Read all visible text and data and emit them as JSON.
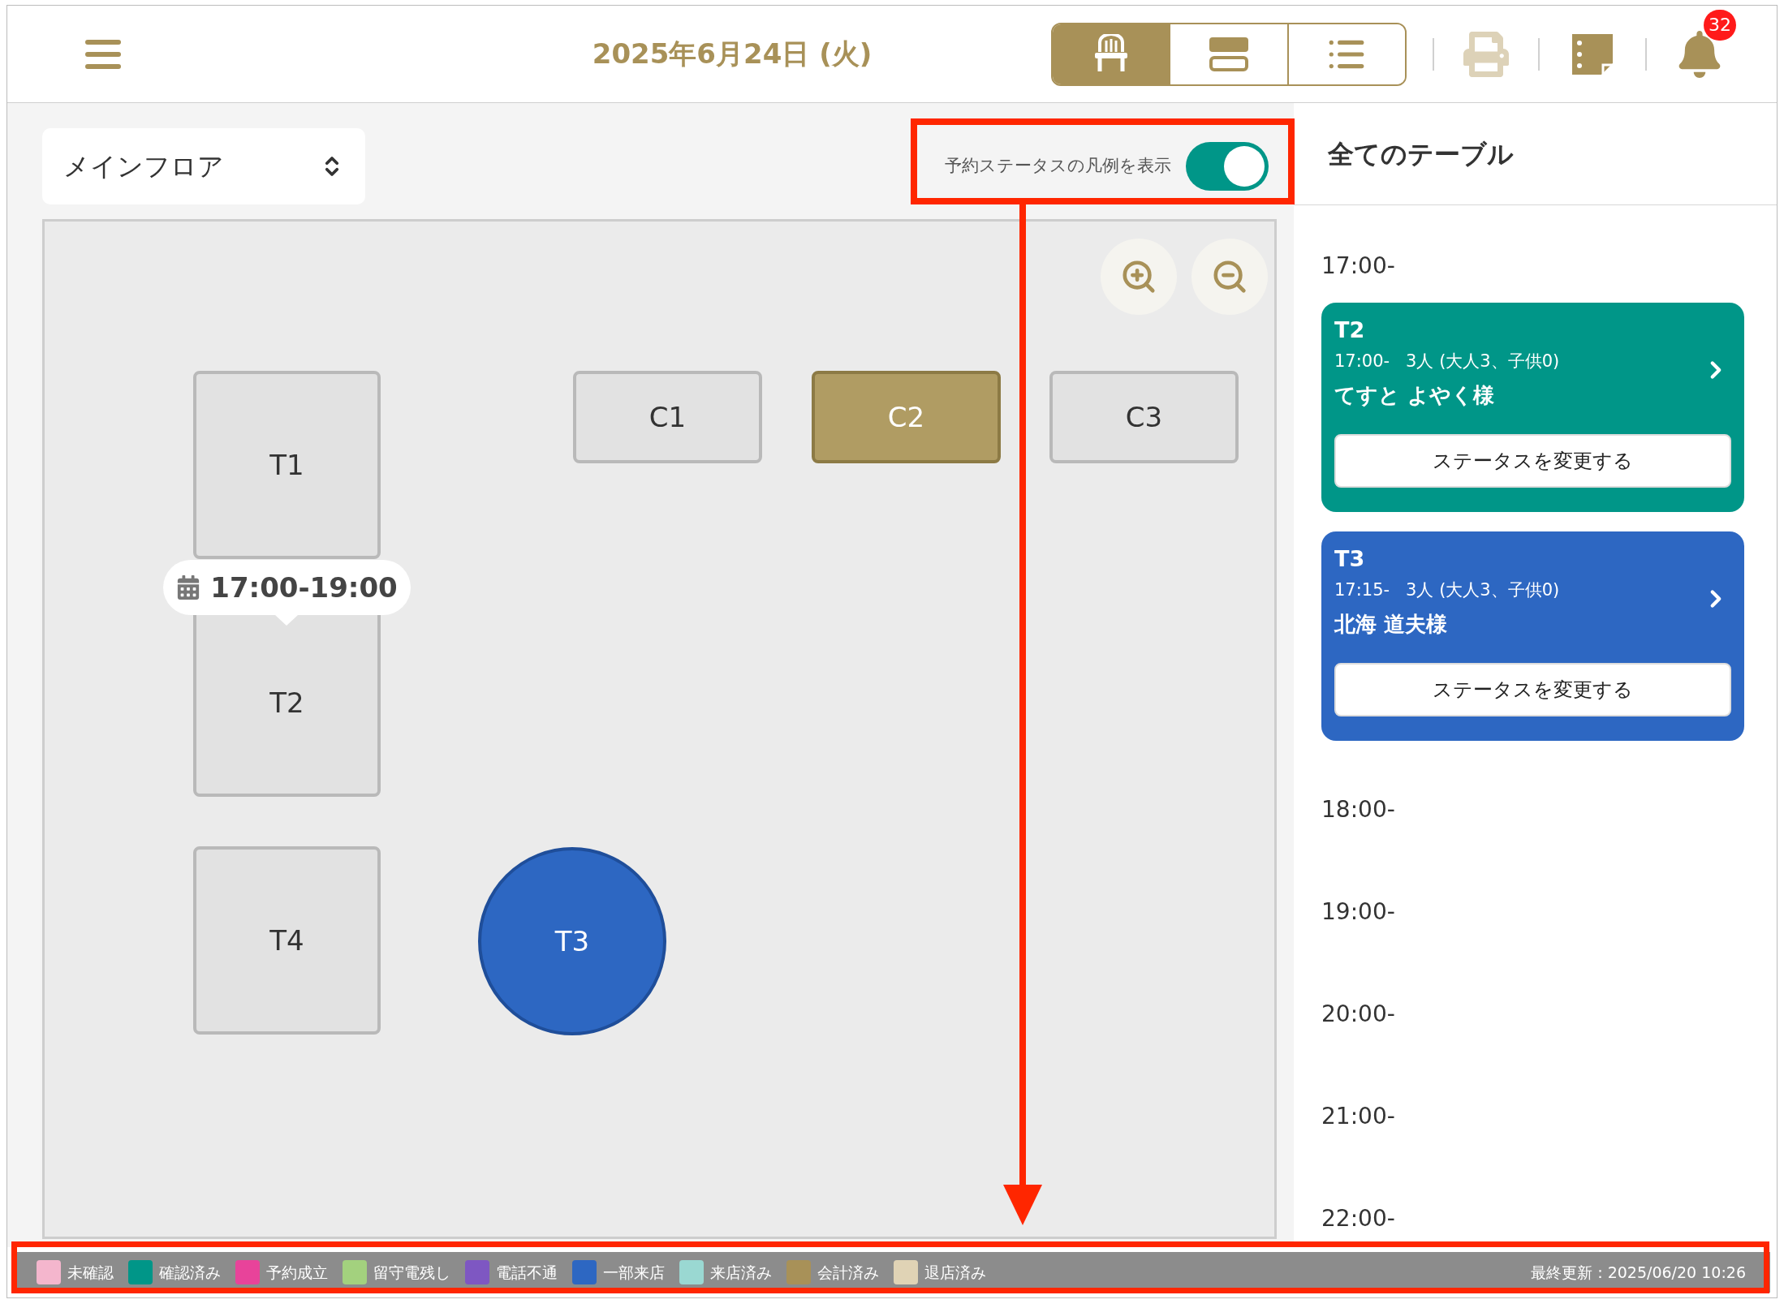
{
  "header": {
    "date": "2025年6月24日 (火)",
    "notification_count": "32"
  },
  "view_tabs": [
    {
      "kind": "seat",
      "selected": true
    },
    {
      "kind": "timeline",
      "selected": false
    },
    {
      "kind": "list",
      "selected": false
    }
  ],
  "floor_select": {
    "value": "メインフロア"
  },
  "legend_toggle": {
    "label": "予約ステータスの凡例を表示",
    "on": true
  },
  "tables": [
    {
      "label": "T1",
      "kind": "rect",
      "selected": false
    },
    {
      "label": "T2",
      "kind": "rect",
      "selected": false
    },
    {
      "label": "T4",
      "kind": "rect",
      "selected": false
    },
    {
      "label": "T3",
      "kind": "circle",
      "selected": false,
      "color": "#2d67c2"
    },
    {
      "label": "C1",
      "kind": "wide",
      "selected": false
    },
    {
      "label": "C2",
      "kind": "wide",
      "selected": true
    },
    {
      "label": "C3",
      "kind": "wide",
      "selected": false
    }
  ],
  "tooltip": {
    "text": "17:00-19:00"
  },
  "side_panel": {
    "title": "全てのテーブル",
    "slots": [
      {
        "time": "17:00-",
        "reservations": [
          {
            "table": "T2",
            "detail": "17:00-   3人 (大人3、子供0)",
            "name": "てすと よやく様",
            "button": "ステータスを変更する",
            "color": "#009688"
          },
          {
            "table": "T3",
            "detail": "17:15-   3人 (大人3、子供0)",
            "name": "北海 道夫様",
            "button": "ステータスを変更する",
            "color": "#2d67c2"
          }
        ]
      },
      {
        "time": "18:00-"
      },
      {
        "time": "19:00-"
      },
      {
        "time": "20:00-"
      },
      {
        "time": "21:00-"
      },
      {
        "time": "22:00-"
      }
    ]
  },
  "legend": {
    "items": [
      {
        "label": "未確認",
        "color": "#f4b6cd"
      },
      {
        "label": "確認済み",
        "color": "#009688"
      },
      {
        "label": "予約成立",
        "color": "#e8439a"
      },
      {
        "label": "留守電残し",
        "color": "#a3d17e"
      },
      {
        "label": "電話不通",
        "color": "#7e57c2"
      },
      {
        "label": "一部来店",
        "color": "#2d67c2"
      },
      {
        "label": "来店済み",
        "color": "#9ad8d2"
      },
      {
        "label": "会計済み",
        "color": "#a89158"
      },
      {
        "label": "退店済み",
        "color": "#e0d3b5"
      }
    ],
    "last_updated": "最終更新：2025/06/20 10:26"
  }
}
